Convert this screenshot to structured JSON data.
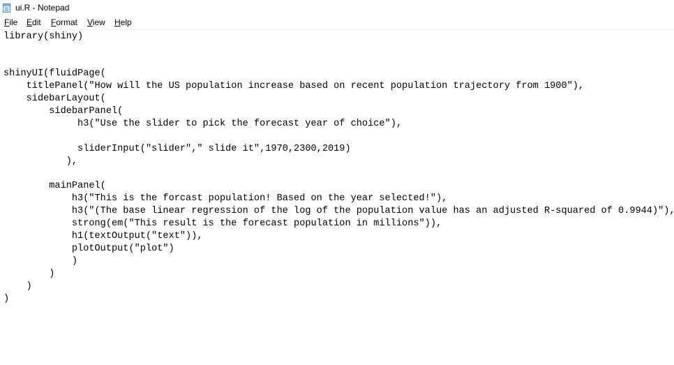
{
  "window": {
    "title": "ui.R - Notepad",
    "icon": "notepad-icon"
  },
  "menubar": {
    "items": [
      {
        "mnemonic": "F",
        "rest": "ile",
        "name": "File"
      },
      {
        "mnemonic": "E",
        "rest": "dit",
        "name": "Edit"
      },
      {
        "mnemonic": "F",
        "rest": "ormat",
        "prefix": "",
        "name": "Format"
      },
      {
        "mnemonic": "V",
        "rest": "iew",
        "name": "View"
      },
      {
        "mnemonic": "H",
        "rest": "elp",
        "name": "Help"
      }
    ]
  },
  "editor": {
    "lines": [
      "library(shiny)",
      "",
      "",
      "shinyUI(fluidPage(",
      "    titlePanel(\"How will the US population increase based on recent population trajectory from 1900\"),",
      "    sidebarLayout(",
      "        sidebarPanel(",
      "             h3(\"Use the slider to pick the forecast year of choice\"),",
      "",
      "             sliderInput(\"slider\",\" slide it\",1970,2300,2019)",
      "           ),",
      "",
      "        mainPanel(",
      "            h3(\"This is the forcast population! Based on the year selected!\"),",
      "            h3(\"(The base linear regression of the log of the population value has an adjusted R-squared of 0.9944)\"),",
      "            strong(em(\"This result is the forecast population in millions\")),",
      "            h1(textOutput(\"text\")),",
      "            plotOutput(\"plot\")",
      "            )",
      "        )",
      "    )",
      ")"
    ]
  }
}
